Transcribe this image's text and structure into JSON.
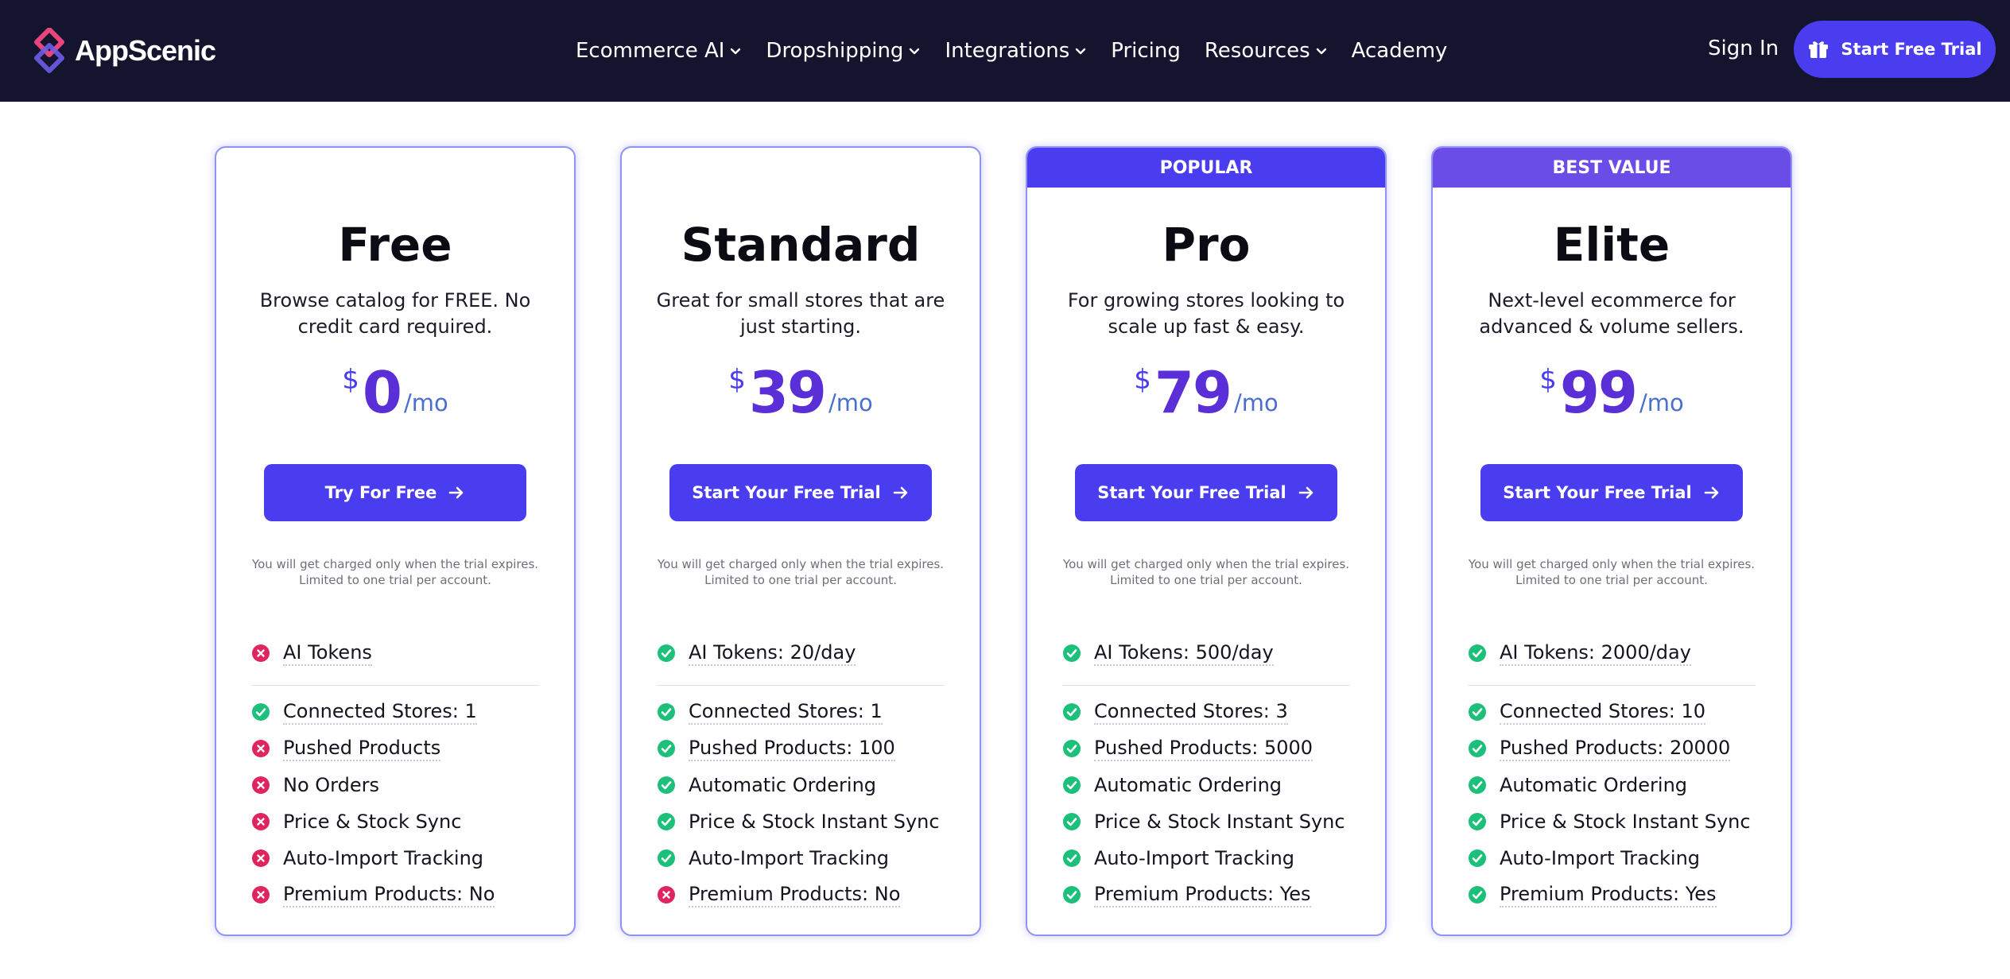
{
  "header": {
    "logo_text": "AppScenic",
    "nav": [
      {
        "label": "Ecommerce AI",
        "dropdown": true
      },
      {
        "label": "Dropshipping",
        "dropdown": true
      },
      {
        "label": "Integrations",
        "dropdown": true
      },
      {
        "label": "Pricing",
        "dropdown": false
      },
      {
        "label": "Resources",
        "dropdown": true
      },
      {
        "label": "Academy",
        "dropdown": false
      }
    ],
    "sign_in": "Sign In",
    "trial_button": "Start Free Trial",
    "trial_icon": "gift-icon"
  },
  "colors": {
    "header_bg": "#15142f",
    "accent": "#4a3df0",
    "best_value": "#6a4ce6",
    "price": "#5b2fd8",
    "check": "#1cc07a",
    "cross": "#e0245e"
  },
  "plans": [
    {
      "ribbon": "",
      "name": "Free",
      "description": "Browse catalog for FREE. No credit card required.",
      "currency": "$",
      "price": "0",
      "period": "/mo",
      "cta": "Try For Free",
      "note": "You will get charged only when the trial expires. Limited to one trial per account.",
      "ai_tokens": {
        "label": "AI Tokens",
        "included": false
      },
      "features": [
        {
          "label": "Connected Stores: 1",
          "included": true,
          "dotted": true
        },
        {
          "label": "Pushed Products",
          "included": false,
          "dotted": true
        },
        {
          "label": "No Orders",
          "included": false,
          "dotted": false
        },
        {
          "label": "Price & Stock Sync",
          "included": false,
          "dotted": false
        },
        {
          "label": "Auto-Import Tracking",
          "included": false,
          "dotted": false
        },
        {
          "label": "Premium Products: No",
          "included": false,
          "dotted": true
        }
      ]
    },
    {
      "ribbon": "",
      "name": "Standard",
      "description": "Great for small stores that are just starting.",
      "currency": "$",
      "price": "39",
      "period": "/mo",
      "cta": "Start Your Free Trial",
      "note": "You will get charged only when the trial expires. Limited to one trial per account.",
      "ai_tokens": {
        "label": "AI Tokens: 20/day",
        "included": true
      },
      "features": [
        {
          "label": "Connected Stores: 1",
          "included": true,
          "dotted": true
        },
        {
          "label": "Pushed Products: 100",
          "included": true,
          "dotted": true
        },
        {
          "label": "Automatic Ordering",
          "included": true,
          "dotted": false
        },
        {
          "label": "Price & Stock Instant Sync",
          "included": true,
          "dotted": false
        },
        {
          "label": "Auto-Import Tracking",
          "included": true,
          "dotted": false
        },
        {
          "label": "Premium Products: No",
          "included": false,
          "dotted": true
        }
      ]
    },
    {
      "ribbon": "POPULAR",
      "ribbon_color": "#4a3df0",
      "name": "Pro",
      "description": "For growing stores looking to scale up fast & easy.",
      "currency": "$",
      "price": "79",
      "period": "/mo",
      "cta": "Start Your Free Trial",
      "note": "You will get charged only when the trial expires. Limited to one trial per account.",
      "ai_tokens": {
        "label": "AI Tokens: 500/day",
        "included": true
      },
      "features": [
        {
          "label": "Connected Stores: 3",
          "included": true,
          "dotted": true
        },
        {
          "label": "Pushed Products: 5000",
          "included": true,
          "dotted": true
        },
        {
          "label": "Automatic Ordering",
          "included": true,
          "dotted": false
        },
        {
          "label": "Price & Stock Instant Sync",
          "included": true,
          "dotted": false
        },
        {
          "label": "Auto-Import Tracking",
          "included": true,
          "dotted": false
        },
        {
          "label": "Premium Products: Yes",
          "included": true,
          "dotted": true
        }
      ]
    },
    {
      "ribbon": "BEST VALUE",
      "ribbon_color": "#6a4ce6",
      "name": "Elite",
      "description": "Next-level ecommerce for advanced & volume sellers.",
      "currency": "$",
      "price": "99",
      "period": "/mo",
      "cta": "Start Your Free Trial",
      "note": "You will get charged only when the trial expires. Limited to one trial per account.",
      "ai_tokens": {
        "label": "AI Tokens: 2000/day",
        "included": true
      },
      "features": [
        {
          "label": "Connected Stores: 10",
          "included": true,
          "dotted": true
        },
        {
          "label": "Pushed Products: 20000",
          "included": true,
          "dotted": true
        },
        {
          "label": "Automatic Ordering",
          "included": true,
          "dotted": false
        },
        {
          "label": "Price & Stock Instant Sync",
          "included": true,
          "dotted": false
        },
        {
          "label": "Auto-Import Tracking",
          "included": true,
          "dotted": false
        },
        {
          "label": "Premium Products: Yes",
          "included": true,
          "dotted": true
        }
      ]
    }
  ]
}
